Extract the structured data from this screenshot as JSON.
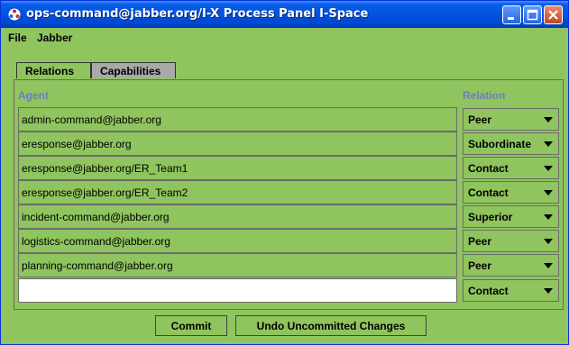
{
  "window": {
    "title": "ops-command@jabber.org/I-X Process Panel I-Space"
  },
  "menu": {
    "items": [
      "File",
      "Jabber"
    ]
  },
  "tabs": [
    {
      "label": "Relations",
      "active": true
    },
    {
      "label": "Capabilities",
      "active": false
    }
  ],
  "table": {
    "headers": {
      "agent": "Agent",
      "relation": "Relation"
    },
    "rows": [
      {
        "agent": "admin-command@jabber.org",
        "relation": "Peer"
      },
      {
        "agent": "eresponse@jabber.org",
        "relation": "Subordinate"
      },
      {
        "agent": "eresponse@jabber.org/ER_Team1",
        "relation": "Contact"
      },
      {
        "agent": "eresponse@jabber.org/ER_Team2",
        "relation": "Contact"
      },
      {
        "agent": "incident-command@jabber.org",
        "relation": "Superior"
      },
      {
        "agent": "logistics-command@jabber.org",
        "relation": "Peer"
      },
      {
        "agent": "planning-command@jabber.org",
        "relation": "Peer"
      }
    ],
    "new_row": {
      "agent": "",
      "relation": "Contact"
    }
  },
  "buttons": {
    "commit": "Commit",
    "undo": "Undo Uncommitted Changes"
  },
  "colors": {
    "background": "#8fc45e",
    "titlebar": "#0054e3",
    "header_text": "#6d7dbd"
  }
}
